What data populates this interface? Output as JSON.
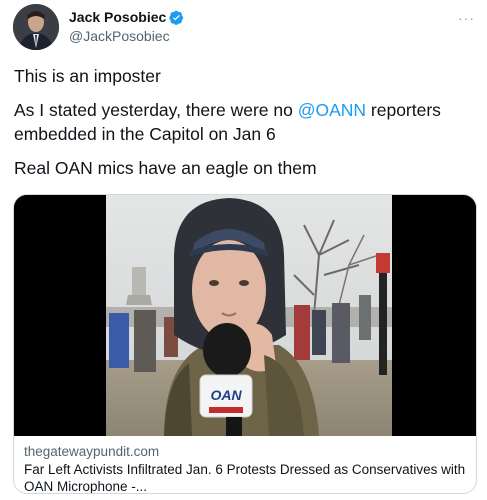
{
  "tweet": {
    "author_name": "Jack Posobiec",
    "author_handle": "@JackPosobiec",
    "more_label": "···",
    "lines": {
      "line1": "This is an imposter",
      "line2_before": "As I stated yesterday, there were no ",
      "line2_mention": "@OANN",
      "line2_after": " reporters embedded in the Capitol on Jan 6",
      "line3": "Real OAN mics have an eagle on them"
    }
  },
  "card": {
    "domain": "thegatewaypundit.com",
    "title": "Far Left Activists Infiltrated Jan. 6 Protests Dressed as Conservatives with OAN Microphone -...",
    "mic_logo_text": "OAN"
  },
  "colors": {
    "link": "#1d9bf0",
    "verified": "#1d9bf0",
    "muted": "#536471"
  }
}
